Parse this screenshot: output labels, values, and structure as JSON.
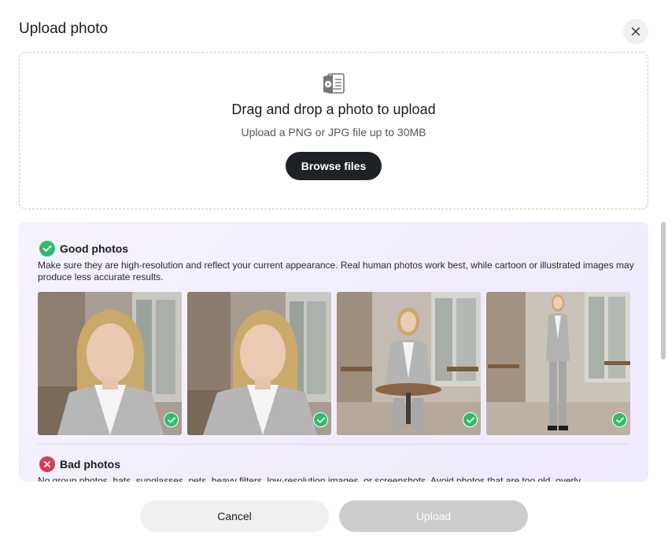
{
  "modal": {
    "title": "Upload photo",
    "close_icon": "close-icon"
  },
  "dropzone": {
    "icon": "photo-file-icon",
    "title": "Drag and drop a photo to upload",
    "subtitle": "Upload a PNG or JPG file up to 30MB",
    "browse_label": "Browse files"
  },
  "guide": {
    "good": {
      "title": "Good photos",
      "icon": "check-circle-icon",
      "description": "Make sure they are high-resolution and reflect your current appearance. Real human photos work best, while cartoon or illustrated images may produce less accurate results.",
      "photos": [
        {
          "kind": "portrait-close",
          "badge": "check-icon"
        },
        {
          "kind": "portrait-close-angled",
          "badge": "check-icon"
        },
        {
          "kind": "seated-at-table",
          "badge": "check-icon"
        },
        {
          "kind": "full-body-standing",
          "badge": "check-icon"
        }
      ]
    },
    "bad": {
      "title": "Bad photos",
      "icon": "x-circle-icon",
      "description": "No group photos, hats, sunglasses, pets, heavy filters, low-resolution images, or screenshots. Avoid photos that are too old, overly"
    }
  },
  "footer": {
    "cancel_label": "Cancel",
    "upload_label": "Upload"
  },
  "colors": {
    "primary_dark": "#1e2125",
    "good_green": "#2fbb6b",
    "bad_red": "#d93b4f",
    "disabled": "#cccccc"
  }
}
